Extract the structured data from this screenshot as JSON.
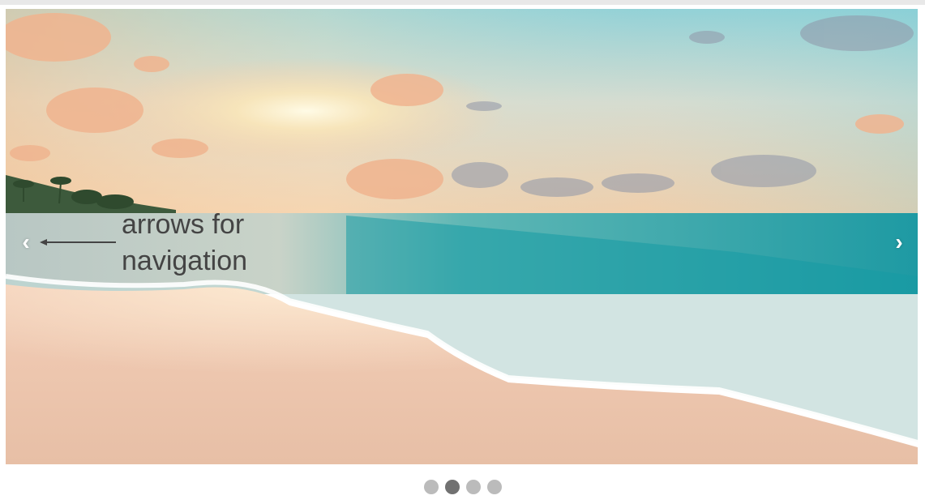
{
  "slideshow": {
    "prev_label": "‹",
    "next_label": "›",
    "annotation": {
      "line1": "arrows for",
      "line2": "navigation"
    },
    "dots": [
      {
        "active": false
      },
      {
        "active": true
      },
      {
        "active": false
      },
      {
        "active": false
      }
    ],
    "active_index": 1,
    "slide_count": 4
  },
  "colors": {
    "dot": "#bbbbbb",
    "dot_active": "#717171",
    "annotation_text": "#444444"
  }
}
